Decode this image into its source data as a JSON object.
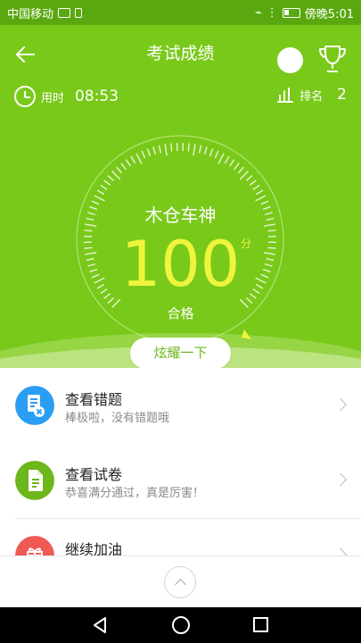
{
  "status_bar": {
    "carrier": "中国移动",
    "time": "傍晚5:01"
  },
  "header": {
    "title": "考试成绩"
  },
  "stats": {
    "time_label": "用时",
    "time_value": "08:53",
    "rank_label": "排名",
    "rank_value": "2"
  },
  "result": {
    "title": "木仓车神",
    "score": "100",
    "unit": "分",
    "status": "合格",
    "share_label": "炫耀一下"
  },
  "list_items": [
    {
      "title": "查看错题",
      "subtitle": "棒极啦，没有错题哦",
      "icon": "wrong-questions-icon",
      "color": "#2a9df4"
    },
    {
      "title": "查看试卷",
      "subtitle": "恭喜满分通过，真是厉害！",
      "icon": "exam-paper-icon",
      "color": "#6db61b"
    },
    {
      "title": "继续加油",
      "subtitle": "",
      "icon": "gift-icon",
      "color": "#f05a55"
    }
  ],
  "colors": {
    "hero_green": "#79c91a",
    "score_yellow": "#eff43d",
    "status_green": "#59a80f"
  }
}
